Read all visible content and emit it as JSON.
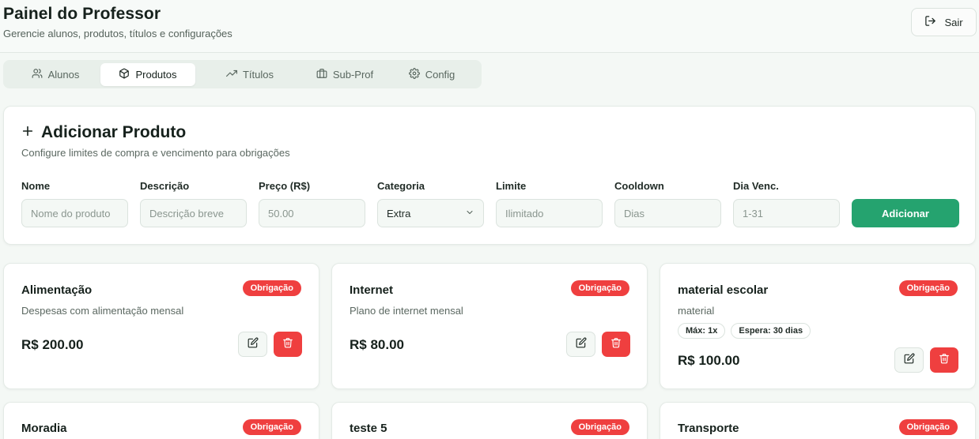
{
  "header": {
    "title": "Painel do Professor",
    "subtitle": "Gerencie alunos, produtos, títulos e configurações",
    "logout_label": "Sair"
  },
  "tabs": [
    {
      "label": "Alunos",
      "icon": "users-icon",
      "active": false
    },
    {
      "label": "Produtos",
      "icon": "package-icon",
      "active": true
    },
    {
      "label": "Títulos",
      "icon": "trending-up-icon",
      "active": false
    },
    {
      "label": "Sub-Prof",
      "icon": "briefcase-icon",
      "active": false
    },
    {
      "label": "Config",
      "icon": "gear-icon",
      "active": false
    }
  ],
  "add_product": {
    "title": "Adicionar Produto",
    "subtitle": "Configure limites de compra e vencimento para obrigações",
    "fields": {
      "name": {
        "label": "Nome",
        "placeholder": "Nome do produto",
        "value": ""
      },
      "description": {
        "label": "Descrição",
        "placeholder": "Descrição breve",
        "value": ""
      },
      "price": {
        "label": "Preço (R$)",
        "placeholder": "50.00",
        "value": ""
      },
      "category": {
        "label": "Categoria",
        "value": "Extra"
      },
      "limit": {
        "label": "Limite",
        "placeholder": "Ilimitado",
        "value": ""
      },
      "cooldown": {
        "label": "Cooldown",
        "placeholder": "Dias",
        "value": ""
      },
      "due_day": {
        "label": "Dia Venc.",
        "placeholder": "1-31",
        "value": ""
      }
    },
    "submit_label": "Adicionar"
  },
  "products": [
    {
      "name": "Alimentação",
      "badge": "Obrigação",
      "description": "Despesas com alimentação mensal",
      "tags": [],
      "price": "R$ 200.00"
    },
    {
      "name": "Internet",
      "badge": "Obrigação",
      "description": "Plano de internet mensal",
      "tags": [],
      "price": "R$ 80.00"
    },
    {
      "name": "material escolar",
      "badge": "Obrigação",
      "description": "material",
      "tags": [
        "Máx: 1x",
        "Espera: 30 dias"
      ],
      "price": "R$ 100.00"
    },
    {
      "name": "Moradia",
      "badge": "Obrigação"
    },
    {
      "name": "teste 5",
      "badge": "Obrigação"
    },
    {
      "name": "Transporte",
      "badge": "Obrigação"
    }
  ],
  "colors": {
    "accent_green": "#25a36f",
    "badge_red": "#ef3f3f",
    "background": "#f4f8f5"
  }
}
